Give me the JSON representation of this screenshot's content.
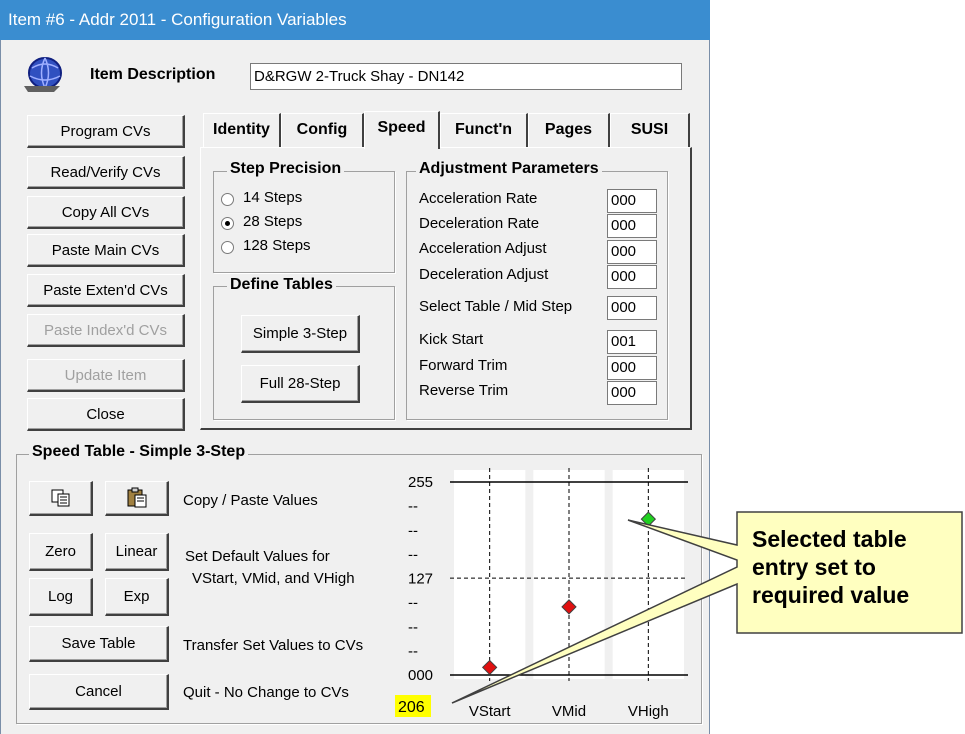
{
  "window": {
    "title": "Item #6 - Addr 2011 - Configuration Variables",
    "item_description_label": "Item Description",
    "item_description_value": "D&RGW 2-Truck Shay - DN142"
  },
  "left_buttons": {
    "program": "Program CVs",
    "read_verify": "Read/Verify CVs",
    "copy_all": "Copy All CVs",
    "paste_main": "Paste Main CVs",
    "paste_extend": "Paste Exten'd CVs",
    "paste_index": "Paste Index'd CVs",
    "update": "Update Item",
    "close": "Close"
  },
  "tabs": [
    "Identity",
    "Config",
    "Speed",
    "Funct'n",
    "Pages",
    "SUSI"
  ],
  "active_tab": "Speed",
  "step_precision": {
    "label": "Step Precision",
    "options": [
      "14 Steps",
      "28 Steps",
      "128 Steps"
    ],
    "selected": "28 Steps"
  },
  "define_tables": {
    "label": "Define Tables",
    "simple": "Simple 3-Step",
    "full": "Full 28-Step"
  },
  "adjustment": {
    "label": "Adjustment Parameters",
    "rows": [
      {
        "label": "Acceleration Rate",
        "value": "000"
      },
      {
        "label": "Deceleration Rate",
        "value": "000"
      },
      {
        "label": "Acceleration Adjust",
        "value": "000"
      },
      {
        "label": "Deceleration Adjust",
        "value": "000"
      },
      {
        "label": "Select Table / Mid Step",
        "value": "000"
      },
      {
        "label": "Kick Start",
        "value": "001"
      },
      {
        "label": "Forward Trim",
        "value": "000"
      },
      {
        "label": "Reverse Trim",
        "value": "000"
      }
    ]
  },
  "speed_table": {
    "label": "Speed Table - Simple 3-Step",
    "copy_paste_text": "Copy / Paste Values",
    "zero": "Zero",
    "linear": "Linear",
    "log": "Log",
    "exp": "Exp",
    "set_default_line1": "Set Default Values for",
    "set_default_line2": "VStart, VMid, and VHigh",
    "save_table": "Save Table",
    "save_text": "Transfer Set Values to CVs",
    "cancel": "Cancel",
    "cancel_text": "Quit - No Change to CVs",
    "selected_value": "206",
    "y_ticks": [
      "255",
      "--",
      "--",
      "--",
      "127",
      "--",
      "--",
      "--",
      "000"
    ]
  },
  "chart_data": {
    "type": "scatter",
    "categories": [
      "VStart",
      "VMid",
      "VHigh"
    ],
    "values": [
      10,
      90,
      206
    ],
    "ylim": [
      0,
      255
    ],
    "point_colors": [
      "#e01010",
      "#e01010",
      "#20d020"
    ]
  },
  "callout": {
    "line1": "Selected table",
    "line2": "entry set to",
    "line3": "required value",
    "color": "#ffffc0"
  },
  "colors": {
    "title_bar": "#3a8dd0",
    "highlight": "#ffff00"
  }
}
